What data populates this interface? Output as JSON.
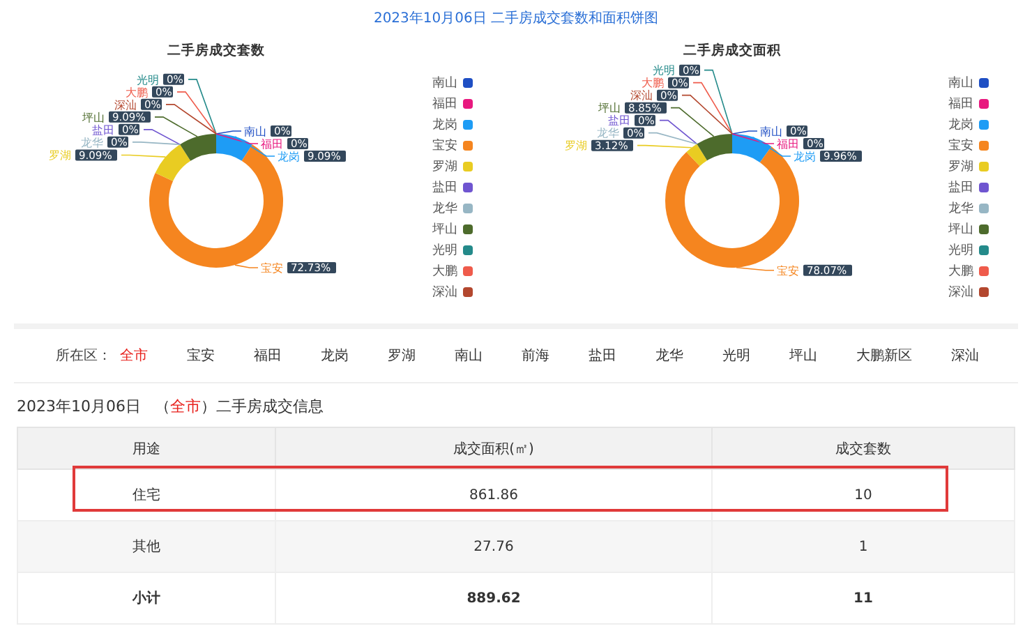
{
  "title": "2023年10月06日 二手房成交套数和面积饼图",
  "charts": [
    {
      "chart_data": {
        "type": "donut",
        "title": "二手房成交套数",
        "categories": [
          "南山",
          "福田",
          "龙岗",
          "宝安",
          "罗湖",
          "盐田",
          "龙华",
          "坪山",
          "光明",
          "大鹏",
          "深汕"
        ],
        "values": [
          0,
          0,
          9.09,
          72.73,
          9.09,
          0,
          0,
          9.09,
          0,
          0,
          0
        ],
        "colors": [
          "#1f4fc4",
          "#e8197f",
          "#1e9cf5",
          "#f5851f",
          "#e9cc22",
          "#6f55d0",
          "#97b6c4",
          "#4d6b2c",
          "#248a8a",
          "#ef5b4b",
          "#b3472e"
        ],
        "value_labels": [
          "0%",
          "0%",
          "9.09%",
          "72.73%",
          "9.09%",
          "0%",
          "0%",
          "9.09%",
          "0%",
          "0%",
          "0%"
        ]
      },
      "legend": [
        {
          "label": "南山",
          "color": "#1f4fc4"
        },
        {
          "label": "福田",
          "color": "#e8197f"
        },
        {
          "label": "龙岗",
          "color": "#1e9cf5"
        },
        {
          "label": "宝安",
          "color": "#f5851f"
        },
        {
          "label": "罗湖",
          "color": "#e9cc22"
        },
        {
          "label": "盐田",
          "color": "#6f55d0"
        },
        {
          "label": "龙华",
          "color": "#97b6c4"
        },
        {
          "label": "坪山",
          "color": "#4d6b2c"
        },
        {
          "label": "光明",
          "color": "#248a8a"
        },
        {
          "label": "大鹏",
          "color": "#ef5b4b"
        },
        {
          "label": "深汕",
          "color": "#b3472e"
        }
      ]
    },
    {
      "chart_data": {
        "type": "donut",
        "title": "二手房成交面积",
        "categories": [
          "南山",
          "福田",
          "龙岗",
          "宝安",
          "罗湖",
          "盐田",
          "龙华",
          "坪山",
          "光明",
          "大鹏",
          "深汕"
        ],
        "values": [
          0,
          0,
          9.96,
          78.07,
          3.12,
          0,
          0,
          8.85,
          0,
          0,
          0
        ],
        "colors": [
          "#1f4fc4",
          "#e8197f",
          "#1e9cf5",
          "#f5851f",
          "#e9cc22",
          "#6f55d0",
          "#97b6c4",
          "#4d6b2c",
          "#248a8a",
          "#ef5b4b",
          "#b3472e"
        ],
        "value_labels": [
          "0%",
          "0%",
          "9.96%",
          "78.07%",
          "3.12%",
          "0%",
          "0%",
          "8.85%",
          "0%",
          "0%",
          "0%"
        ]
      },
      "legend": [
        {
          "label": "南山",
          "color": "#1f4fc4"
        },
        {
          "label": "福田",
          "color": "#e8197f"
        },
        {
          "label": "龙岗",
          "color": "#1e9cf5"
        },
        {
          "label": "宝安",
          "color": "#f5851f"
        },
        {
          "label": "罗湖",
          "color": "#e9cc22"
        },
        {
          "label": "盐田",
          "color": "#6f55d0"
        },
        {
          "label": "龙华",
          "color": "#97b6c4"
        },
        {
          "label": "坪山",
          "color": "#4d6b2c"
        },
        {
          "label": "光明",
          "color": "#248a8a"
        },
        {
          "label": "大鹏",
          "color": "#ef5b4b"
        },
        {
          "label": "深汕",
          "color": "#b3472e"
        }
      ]
    }
  ],
  "district_filter": {
    "label": "所在区：",
    "options": [
      {
        "label": "全市",
        "selected": true
      },
      {
        "label": "宝安",
        "selected": false
      },
      {
        "label": "福田",
        "selected": false
      },
      {
        "label": "龙岗",
        "selected": false
      },
      {
        "label": "罗湖",
        "selected": false
      },
      {
        "label": "南山",
        "selected": false
      },
      {
        "label": "前海",
        "selected": false
      },
      {
        "label": "盐田",
        "selected": false
      },
      {
        "label": "龙华",
        "selected": false
      },
      {
        "label": "光明",
        "selected": false
      },
      {
        "label": "坪山",
        "selected": false
      },
      {
        "label": "大鹏新区",
        "selected": false
      },
      {
        "label": "深汕",
        "selected": false
      }
    ]
  },
  "info_heading": {
    "parts": [
      {
        "text": "2023年10月06日",
        "accent": false
      },
      {
        "text": "（",
        "accent": false
      },
      {
        "text": "全市",
        "accent": true
      },
      {
        "text": "）二手房成交信息",
        "accent": false
      }
    ]
  },
  "table": {
    "columns": [
      "用途",
      "成交面积(㎡)",
      "成交套数"
    ],
    "rows": [
      {
        "kind": "data",
        "highlighted": true,
        "cells": [
          "住宅",
          "861.86",
          "10"
        ]
      },
      {
        "kind": "data",
        "highlighted": false,
        "cells": [
          "其他",
          "27.76",
          "1"
        ]
      },
      {
        "kind": "total",
        "highlighted": false,
        "cells": [
          "小计",
          "889.62",
          "11"
        ]
      }
    ]
  }
}
